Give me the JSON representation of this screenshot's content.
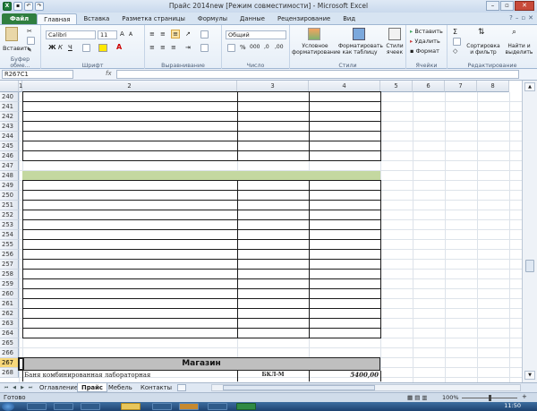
{
  "window": {
    "title": "Прайс 2014new  [Режим совместимости]  -  Microsoft Excel",
    "app_icon": "X"
  },
  "ribbon_tabs": [
    "Файл",
    "Главная",
    "Вставка",
    "Разметка страницы",
    "Формулы",
    "Данные",
    "Рецензирование",
    "Вид"
  ],
  "ribbon": {
    "clipboard": {
      "paste": "Вставить",
      "label": "Буфер обме..."
    },
    "font": {
      "name": "Calibri",
      "size": "11",
      "label": "Шрифт",
      "bold": "Ж",
      "italic": "К",
      "underline": "Ч"
    },
    "alignment": {
      "label": "Выравнивание"
    },
    "number": {
      "format": "Общий",
      "label": "Число",
      "percent": "%",
      "thousands": "000"
    },
    "styles": {
      "conditional": "Условное форматирование",
      "as_table": "Форматировать как таблицу",
      "cell_styles": "Стили ячеек",
      "label": "Стили"
    },
    "cells": {
      "insert": "Вставить",
      "delete": "Удалить",
      "format": "Формат",
      "label": "Ячейки"
    },
    "editing": {
      "sort": "Сортировка и фильтр",
      "find": "Найти и выделить",
      "label": "Редактирование",
      "sum": "Σ"
    }
  },
  "formula_bar": {
    "name_box": "R267C1",
    "fx": "fx",
    "formula": ""
  },
  "columns": [
    "1",
    "2",
    "3",
    "4",
    "5",
    "6",
    "7",
    "8"
  ],
  "rows": [
    "240",
    "241",
    "242",
    "243",
    "244",
    "245",
    "246",
    "247",
    "248",
    "249",
    "250",
    "251",
    "252",
    "253",
    "254",
    "255",
    "256",
    "257",
    "258",
    "259",
    "260",
    "261",
    "262",
    "263",
    "264",
    "265",
    "266",
    "267",
    "268"
  ],
  "cells": {
    "row267_title": "Магазин",
    "row268_name": "Баня комбинированная лабораторная",
    "row268_code": "БКЛ-М",
    "row268_price": "5400,00"
  },
  "sheets": [
    "Оглавление",
    "Прайс",
    "Мебель",
    "Контакты"
  ],
  "active_sheet": "Прайс",
  "status": {
    "ready": "Готово",
    "zoom": "100%"
  },
  "clock": "11:50"
}
